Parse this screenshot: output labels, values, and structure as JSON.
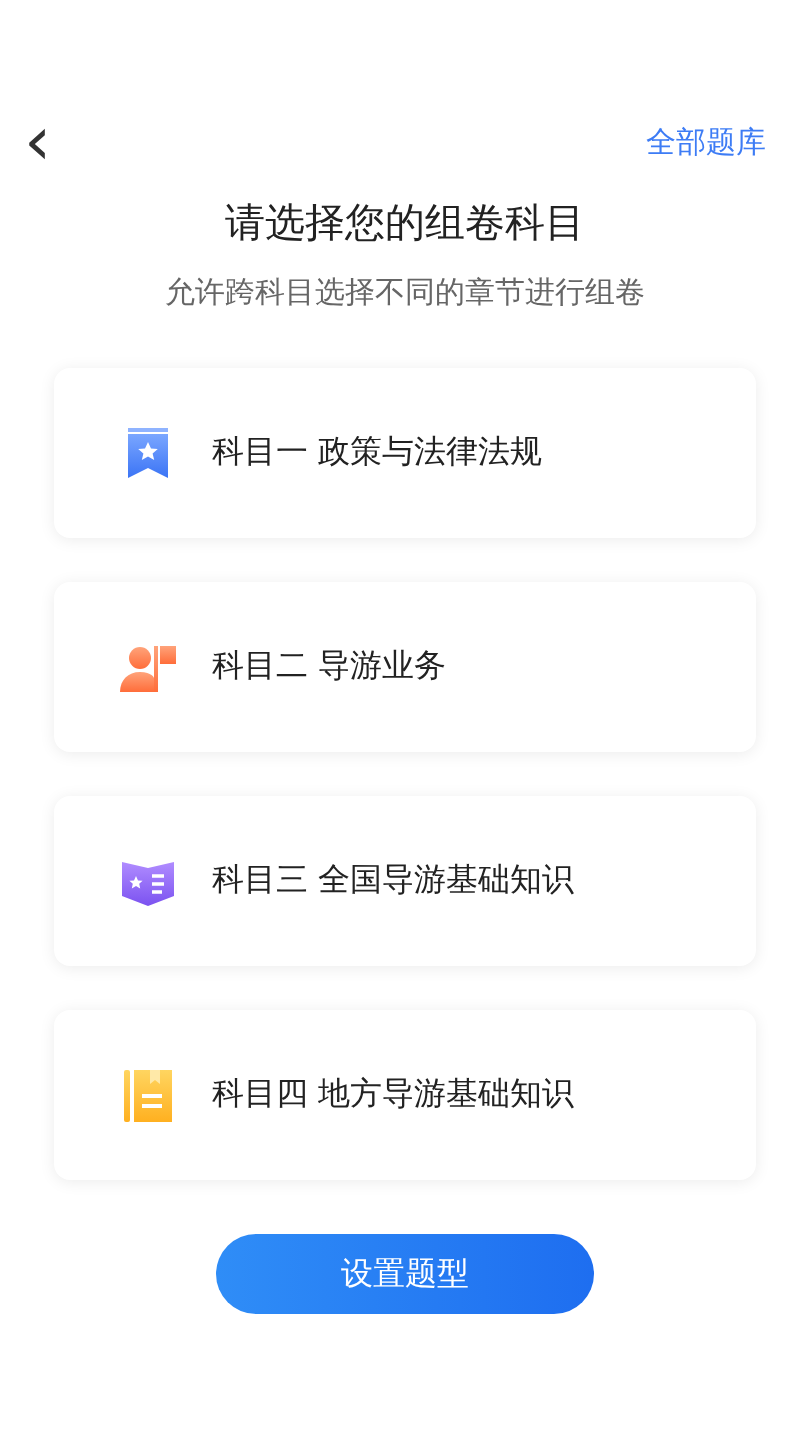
{
  "header": {
    "back": "‹",
    "action": "全部题库"
  },
  "title": "请选择您的组卷科目",
  "subtitle": "允许跨科目选择不同的章节进行组卷",
  "subjects": [
    {
      "kind": "bookmark",
      "label": "科目一 政策与法律法规"
    },
    {
      "kind": "guide",
      "label": "科目二 导游业务"
    },
    {
      "kind": "book",
      "label": "科目三 全国导游基础知识"
    },
    {
      "kind": "notepad",
      "label": "科目四 地方导游基础知识"
    }
  ],
  "button": "设置题型"
}
